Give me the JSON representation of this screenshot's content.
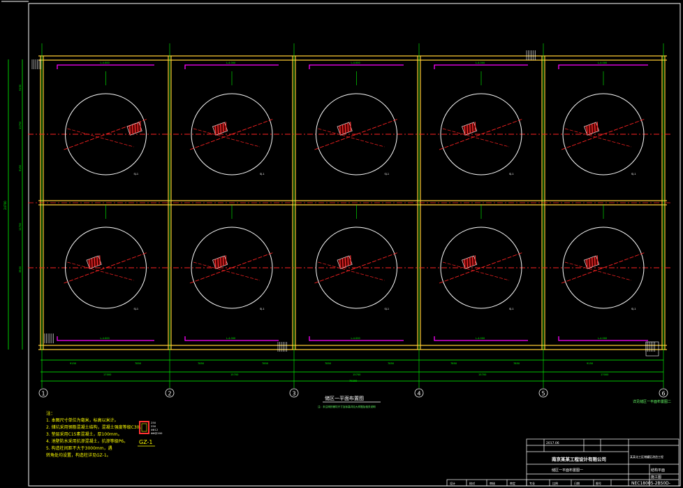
{
  "drawing": {
    "overall_dims": [
      "24700",
      "79200"
    ],
    "left_dims": [
      "9150",
      "11700",
      "9150",
      "11700",
      "3500"
    ],
    "bottom_dims": [
      "9150",
      "7850",
      "7850",
      "7850",
      "7850",
      "7850",
      "7850",
      "7850",
      "9150"
    ],
    "bottom_spans": [
      "17000",
      "15700",
      "15700",
      "15700",
      "17000"
    ],
    "axis_labels": [
      "1",
      "2",
      "3",
      "4",
      "5",
      "6"
    ],
    "slab_mark": "L-4.000",
    "pit_mark": "SJ-1",
    "plan_title": "储区一平面布置图",
    "plan_subtitle": "注：未注明的储坑尺寸及标高详见大样图及相关说明",
    "right_caption": "详见储区一平面布置图二",
    "column_label": "GZ-1",
    "column_dims": [
      "250",
      "250",
      "4Φ12",
      "Φ6@200"
    ],
    "notes_title": "注：",
    "notes": [
      "1. 本图尺寸单位为毫米，标高以米计。",
      "2. 储坑采用钢筋混凝土结构，混凝土强度等级C30。",
      "3. 垫层采用C15素混凝土，厚100mm。",
      "4. 池壁防水采用抗渗混凝土，抗渗等级P6。",
      "5. 构造柱间距不大于3000mm，遇",
      "   转角处均设置，构造柱详见GZ-1。"
    ]
  },
  "title_block": {
    "company": "南京某某工程设计有限公司",
    "project": "某某化工区储罐区改造工程",
    "drawing_name": "储区一平面布置图一",
    "sheet_title": "结构平面",
    "stage": "施工图",
    "date": "2017.06",
    "drawing_no": "NEC18005-2BS0D-",
    "labels": [
      "设计",
      "校对",
      "审核",
      "审定",
      "专业",
      "比例",
      "日期",
      "图号"
    ]
  },
  "colors": {
    "background": "#000000",
    "frame": "#ffffff",
    "wall": "#ffcc33",
    "axis": "#ff2222",
    "dimension": "#00ff00",
    "pit_outline": "#ff00ff",
    "tank": "#ffffff",
    "hatch": "#ff3333",
    "text_yellow": "#ffff00"
  }
}
